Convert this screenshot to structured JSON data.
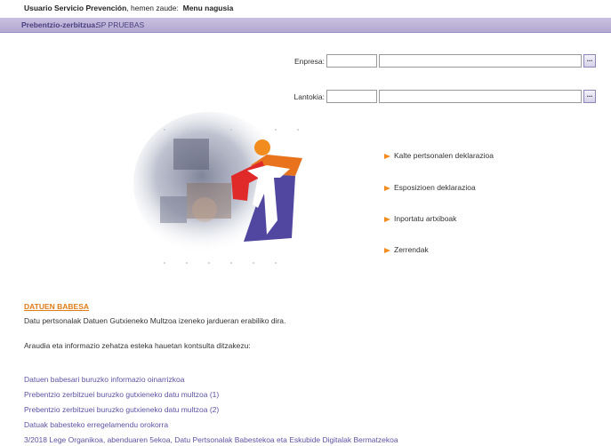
{
  "header": {
    "user": "Usuario Servicio Prevención",
    "location_text": ", hemen zaude:",
    "menu_link": "Menu nagusia"
  },
  "service": {
    "label": "Prebentzio-zerbitzua:",
    "value": "SP PRUEBAS"
  },
  "form": {
    "empresa_label": "Enpresa:",
    "lantokia_label": "Lantokia:",
    "lookup_button": "..."
  },
  "menu": {
    "items": [
      "Kalte pertsonalen deklarazioa",
      "Esposizioen deklarazioa",
      "Inportatu artxiboak",
      "Zerrendak"
    ]
  },
  "data_protection": {
    "title": "DATUEN BABESA",
    "text1": "Datu pertsonalak Datuen Gutxieneko Multzoa izeneko jardueran erabiliko dira.",
    "text2": "Araudia eta informazio zehatza esteka hauetan kontsulta ditzakezu:",
    "links": [
      "Datuen babesari buruzko informazio oinarrizkoa",
      "Prebentzio zerbitzuei buruzko gutxieneko datu multzoa (1)",
      "Prebentzio zerbitzuei buruzko gutxieneko datu multzoa (2)",
      "Datuak babesteko erregelamendu orokorra",
      "3/2018 Lege Organikoa, abenduaren 5ekoa, Datu Pertsonalak Babestekoa eta Eskubide Digitalak Bermatzekoa"
    ]
  },
  "colors": {
    "accent_orange": "#f28c1e",
    "link_purple": "#5b53a3",
    "bar_purple": "#b3a9d2"
  }
}
